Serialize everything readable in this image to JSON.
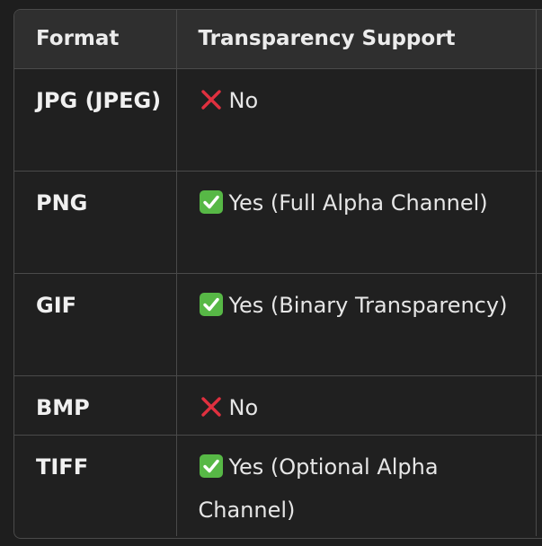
{
  "table": {
    "headers": [
      "Format",
      "Transparency Support",
      ""
    ],
    "rows": [
      {
        "format": "JPG (JPEG)",
        "support": "No",
        "icon": "cross-mark-icon"
      },
      {
        "format": "PNG",
        "support": "Yes (Full Alpha Channel)",
        "icon": "check-mark-icon"
      },
      {
        "format": "GIF",
        "support": "Yes (Binary Transparency)",
        "icon": "check-mark-icon"
      },
      {
        "format": "BMP",
        "support": "No",
        "icon": "cross-mark-icon"
      },
      {
        "format": "TIFF",
        "support": "Yes (Optional Alpha Channel)",
        "icon": "check-mark-icon"
      }
    ]
  },
  "colors": {
    "cross": "#e0303f",
    "check_bg": "#57b846",
    "check_mark": "#ffffff",
    "header_bg": "#2f2f2f",
    "body_bg": "#202020",
    "border": "#4a4a4a"
  }
}
